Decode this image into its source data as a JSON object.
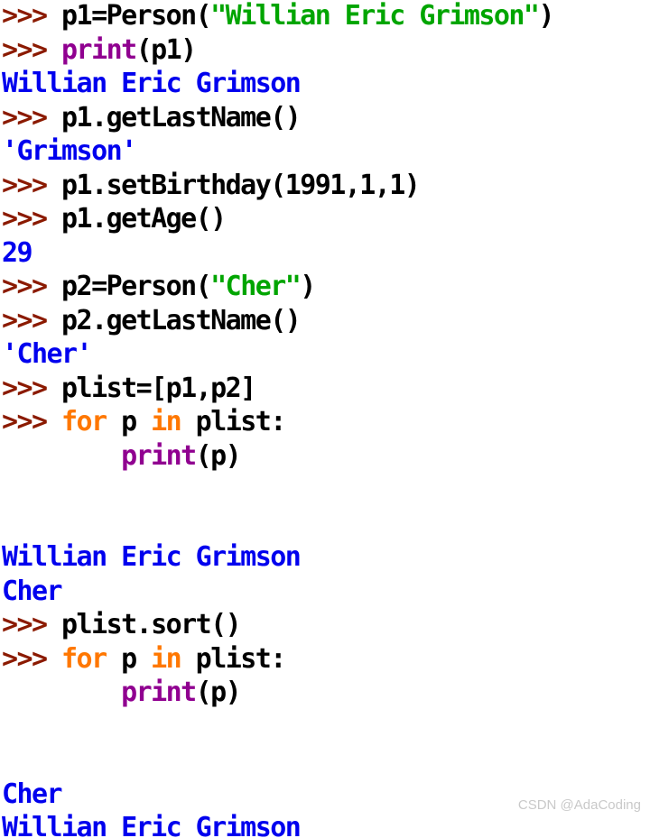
{
  "app": {
    "kind": "python-idle-shell",
    "background_color": "#ffffff",
    "prompt": ">>> ",
    "continuation_indent": "        "
  },
  "colors": {
    "prompt": "#8b1a00",
    "plain": "#000000",
    "string": "#00a500",
    "builtin": "#900090",
    "keyword": "#ff7700",
    "output": "#0000ee",
    "watermark": "#c9c9c9",
    "background": "#ffffff"
  },
  "watermark": {
    "text": "CSDN @AdaCoding"
  },
  "session": {
    "lines": [
      {
        "id": "line-1",
        "kind": "input",
        "text": ">>> p1=Person(\"Willian Eric Grimson\")",
        "tokens": [
          {
            "t": ">>> ",
            "c": "prompt"
          },
          {
            "t": "p1=Person(",
            "c": "plain"
          },
          {
            "t": "\"Willian Eric Grimson\"",
            "c": "string"
          },
          {
            "t": ")",
            "c": "plain"
          }
        ]
      },
      {
        "id": "line-2",
        "kind": "input",
        "text": ">>> print(p1)",
        "tokens": [
          {
            "t": ">>> ",
            "c": "prompt"
          },
          {
            "t": "print",
            "c": "builtin"
          },
          {
            "t": "(p1)",
            "c": "plain"
          }
        ]
      },
      {
        "id": "line-3",
        "kind": "output",
        "text": "Willian Eric Grimson",
        "tokens": [
          {
            "t": "Willian Eric Grimson",
            "c": "output"
          }
        ]
      },
      {
        "id": "line-4",
        "kind": "input",
        "text": ">>> p1.getLastName()",
        "tokens": [
          {
            "t": ">>> ",
            "c": "prompt"
          },
          {
            "t": "p1.getLastName()",
            "c": "plain"
          }
        ]
      },
      {
        "id": "line-5",
        "kind": "output",
        "text": "'Grimson'",
        "tokens": [
          {
            "t": "'Grimson'",
            "c": "output"
          }
        ]
      },
      {
        "id": "line-6",
        "kind": "input",
        "text": ">>> p1.setBirthday(1991,1,1)",
        "tokens": [
          {
            "t": ">>> ",
            "c": "prompt"
          },
          {
            "t": "p1.setBirthday(1991,1,1)",
            "c": "plain"
          }
        ]
      },
      {
        "id": "line-7",
        "kind": "input",
        "text": ">>> p1.getAge()",
        "tokens": [
          {
            "t": ">>> ",
            "c": "prompt"
          },
          {
            "t": "p1.getAge()",
            "c": "plain"
          }
        ]
      },
      {
        "id": "line-8",
        "kind": "output",
        "text": "29",
        "tokens": [
          {
            "t": "29",
            "c": "output"
          }
        ]
      },
      {
        "id": "line-9",
        "kind": "input",
        "text": ">>> p2=Person(\"Cher\")",
        "tokens": [
          {
            "t": ">>> ",
            "c": "prompt"
          },
          {
            "t": "p2=Person(",
            "c": "plain"
          },
          {
            "t": "\"Cher\"",
            "c": "string"
          },
          {
            "t": ")",
            "c": "plain"
          }
        ]
      },
      {
        "id": "line-10",
        "kind": "input",
        "text": ">>> p2.getLastName()",
        "tokens": [
          {
            "t": ">>> ",
            "c": "prompt"
          },
          {
            "t": "p2.getLastName()",
            "c": "plain"
          }
        ]
      },
      {
        "id": "line-11",
        "kind": "output",
        "text": "'Cher'",
        "tokens": [
          {
            "t": "'Cher'",
            "c": "output"
          }
        ]
      },
      {
        "id": "line-12",
        "kind": "input",
        "text": ">>> plist=[p1,p2]",
        "tokens": [
          {
            "t": ">>> ",
            "c": "prompt"
          },
          {
            "t": "plist=[p1,p2]",
            "c": "plain"
          }
        ]
      },
      {
        "id": "line-13",
        "kind": "input",
        "text": ">>> for p in plist:",
        "tokens": [
          {
            "t": ">>> ",
            "c": "prompt"
          },
          {
            "t": "for",
            "c": "keyword"
          },
          {
            "t": " p ",
            "c": "plain"
          },
          {
            "t": "in",
            "c": "keyword"
          },
          {
            "t": " plist:",
            "c": "plain"
          }
        ]
      },
      {
        "id": "line-14",
        "kind": "input",
        "text": "        print(p)",
        "tokens": [
          {
            "t": "        ",
            "c": "plain"
          },
          {
            "t": "print",
            "c": "builtin"
          },
          {
            "t": "(p)",
            "c": "plain"
          }
        ]
      },
      {
        "id": "line-15",
        "kind": "blank",
        "text": "",
        "tokens": []
      },
      {
        "id": "line-16",
        "kind": "blank",
        "text": "",
        "tokens": []
      },
      {
        "id": "line-17",
        "kind": "output",
        "text": "Willian Eric Grimson",
        "tokens": [
          {
            "t": "Willian Eric Grimson",
            "c": "output"
          }
        ]
      },
      {
        "id": "line-18",
        "kind": "output",
        "text": "Cher",
        "tokens": [
          {
            "t": "Cher",
            "c": "output"
          }
        ]
      },
      {
        "id": "line-19",
        "kind": "input",
        "text": ">>> plist.sort()",
        "tokens": [
          {
            "t": ">>> ",
            "c": "prompt"
          },
          {
            "t": "plist.sort()",
            "c": "plain"
          }
        ]
      },
      {
        "id": "line-20",
        "kind": "input",
        "text": ">>> for p in plist:",
        "tokens": [
          {
            "t": ">>> ",
            "c": "prompt"
          },
          {
            "t": "for",
            "c": "keyword"
          },
          {
            "t": " p ",
            "c": "plain"
          },
          {
            "t": "in",
            "c": "keyword"
          },
          {
            "t": " plist:",
            "c": "plain"
          }
        ]
      },
      {
        "id": "line-21",
        "kind": "input",
        "text": "        print(p)",
        "tokens": [
          {
            "t": "        ",
            "c": "plain"
          },
          {
            "t": "print",
            "c": "builtin"
          },
          {
            "t": "(p)",
            "c": "plain"
          }
        ]
      },
      {
        "id": "line-22",
        "kind": "blank",
        "text": "",
        "tokens": []
      },
      {
        "id": "line-23",
        "kind": "blank",
        "text": "",
        "tokens": []
      },
      {
        "id": "line-24",
        "kind": "output",
        "text": "Cher",
        "tokens": [
          {
            "t": "Cher",
            "c": "output"
          }
        ]
      },
      {
        "id": "line-25",
        "kind": "output",
        "text": "Willian Eric Grimson",
        "tokens": [
          {
            "t": "Willian Eric Grimson",
            "c": "output"
          }
        ]
      }
    ]
  }
}
